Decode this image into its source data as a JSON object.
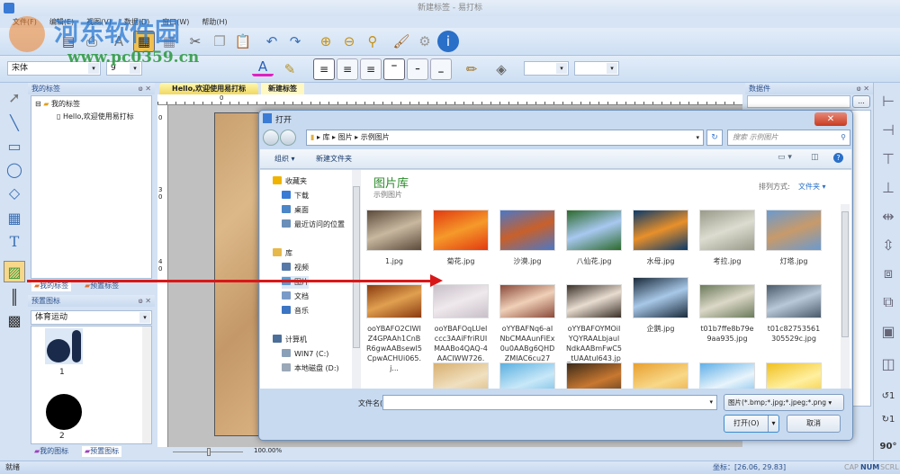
{
  "app": {
    "title": "新建标签 - 易打标",
    "watermark_cn": "河东软件园",
    "watermark_url": "www.pc0359.cn"
  },
  "menu": [
    "文件(F)",
    "编辑(E)",
    "视图(V)",
    "数据(D)",
    "窗口(W)",
    "帮助(H)"
  ],
  "format": {
    "font": "宋体",
    "size": "9",
    "bold": "B",
    "italic": "I",
    "underline": "U",
    "wordart": "W"
  },
  "left_panel": {
    "title": "我的标签",
    "tree_root": "我的标签",
    "tree_child": "Hello,欢迎使用易打标",
    "tabs": [
      "我的标签",
      "预置标签"
    ],
    "icons_title": "预置图标",
    "category": "体育运动",
    "icons": [
      {
        "label": "1",
        "name": "bowling-icon"
      },
      {
        "label": "2",
        "name": "basketball-icon"
      }
    ],
    "icon_tabs": [
      "我的图标",
      "预置图标"
    ]
  },
  "doc_tabs": [
    "Hello,欢迎使用易打标",
    "新建标签"
  ],
  "ruler": {
    "top_zero": "0",
    "left": [
      "0",
      "3",
      "0",
      "4",
      "0"
    ]
  },
  "zoom": "100.00%",
  "right_panel": {
    "title": "数据件",
    "button": "..."
  },
  "rotate_labels": [
    "1",
    "1",
    "90"
  ],
  "dialog": {
    "title": "打开",
    "breadcrumb": [
      "库",
      "图片",
      "示例图片"
    ],
    "search_placeholder": "搜索 示例图片",
    "organize": "组织 ▾",
    "new_folder": "新建文件夹",
    "library_title": "图片库",
    "library_sub": "示例图片",
    "sort_label": "排列方式:",
    "sort_value": "文件夹 ▾",
    "nav": [
      {
        "label": "收藏夹",
        "icon": "star-icon",
        "color": "#f0b400",
        "indent": 0
      },
      {
        "label": "下载",
        "icon": "download-folder-icon",
        "color": "#3a7bd5",
        "indent": 1
      },
      {
        "label": "桌面",
        "icon": "desktop-icon",
        "color": "#4a86c8",
        "indent": 1
      },
      {
        "label": "最近访问的位置",
        "icon": "recent-icon",
        "color": "#6a8fb8",
        "indent": 1
      },
      {
        "label": "库",
        "icon": "library-icon",
        "color": "#e7b94a",
        "indent": 0
      },
      {
        "label": "视频",
        "icon": "video-icon",
        "color": "#5779a8",
        "indent": 1
      },
      {
        "label": "图片",
        "icon": "pictures-icon",
        "color": "#5a9ad0",
        "indent": 1
      },
      {
        "label": "文档",
        "icon": "documents-icon",
        "color": "#7a9ac8",
        "indent": 1
      },
      {
        "label": "音乐",
        "icon": "music-icon",
        "color": "#3b75c4",
        "indent": 1
      },
      {
        "label": "计算机",
        "icon": "computer-icon",
        "color": "#4c6f99",
        "indent": 0
      },
      {
        "label": "WIN7 (C:)",
        "icon": "drive-icon",
        "color": "#8aa0b8",
        "indent": 1
      },
      {
        "label": "本地磁盘 (D:)",
        "icon": "drive-icon",
        "color": "#9aa8b8",
        "indent": 1
      }
    ],
    "files": [
      {
        "name": "1.jpg",
        "c1": "#5b4a3a",
        "c2": "#c9b8a0"
      },
      {
        "name": "菊花.jpg",
        "c1": "#e23a10",
        "c2": "#f59a2a"
      },
      {
        "name": "沙漠.jpg",
        "c1": "#4a78c8",
        "c2": "#c8602a"
      },
      {
        "name": "八仙花.jpg",
        "c1": "#2c6a2c",
        "c2": "#a8c8f0"
      },
      {
        "name": "水母.jpg",
        "c1": "#0a3a6a",
        "c2": "#e8902a"
      },
      {
        "name": "考拉.jpg",
        "c1": "#9a9a8a",
        "c2": "#dcdcd0"
      },
      {
        "name": "灯塔.jpg",
        "c1": "#6a9ad0",
        "c2": "#c89a6a"
      },
      {
        "name": "ooYBAFO2CIWIZ4GPAAh1CnBR6gwAABsewI5CpwACHUi065.j...",
        "c1": "#8a3a10",
        "c2": "#e0a050"
      },
      {
        "name": "ooYBAFOqLUeIccc3AAiFfriRUIMAABo4QAQ-4AACIWW726.j...",
        "c1": "#c8c0c8",
        "c2": "#efe8ec"
      },
      {
        "name": "oYYBAFNq6-aINbCMAAunFiEx0u0AABg6QHDZMIAC6cu273....",
        "c1": "#8a4a3a",
        "c2": "#f0d0b8"
      },
      {
        "name": "oYYBAFOYMOiIYQYRAALbjaulNdkAABmFwC5_tUAAtul643.jpg",
        "c1": "#3a3028",
        "c2": "#e8dcd0"
      },
      {
        "name": "企鹅.jpg",
        "c1": "#1a2a3a",
        "c2": "#a8c8e8"
      },
      {
        "name": "t01b7ffe8b79e9aa935.jpg",
        "c1": "#6a7a5a",
        "c2": "#dcd8c8"
      },
      {
        "name": "t01c82753561305529c.jpg",
        "c1": "#4a5a6a",
        "c2": "#b8c8d8"
      },
      {
        "name": "",
        "c1": "#d8b070",
        "c2": "#f0e0c0"
      },
      {
        "name": "",
        "c1": "#5ab0e0",
        "c2": "#c8e8f8"
      },
      {
        "name": "",
        "c1": "#3a2a1a",
        "c2": "#c87830"
      },
      {
        "name": "",
        "c1": "#e8a030",
        "c2": "#f8d888"
      },
      {
        "name": "",
        "c1": "#60b0e8",
        "c2": "#e8f4fb"
      },
      {
        "name": "",
        "c1": "#f0c020",
        "c2": "#fff0a0"
      }
    ],
    "filename_label": "文件名(N):",
    "filename_value": "",
    "filter": "图片(*.bmp;*.jpg;*.jpeg;*.png",
    "open": "打开(O)",
    "cancel": "取消"
  },
  "status": {
    "ready": "就绪",
    "coords": "坐标：[26.06, 29.83]",
    "keys": [
      "CAP",
      "NUM",
      "SCRL"
    ]
  }
}
